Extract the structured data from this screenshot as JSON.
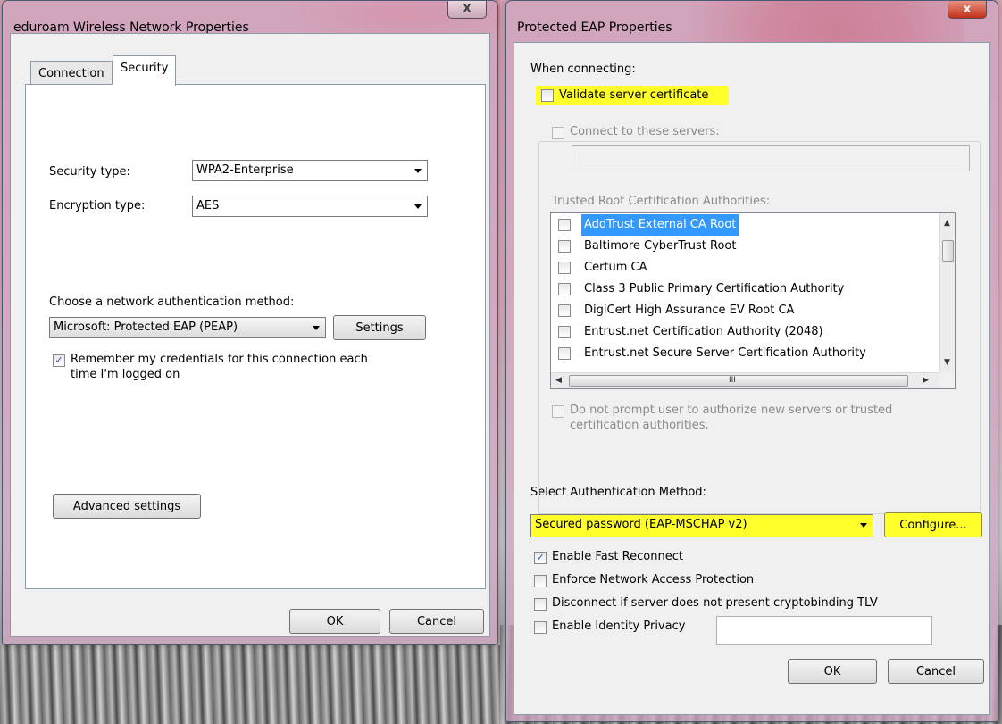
{
  "left_dialog": {
    "title": "eduroam Wireless Network Properties",
    "close_glyph": "X",
    "tabs": [
      {
        "label": "Connection"
      },
      {
        "label": "Security"
      }
    ],
    "security_type_label": "Security type:",
    "security_type_value": "WPA2-Enterprise",
    "encryption_type_label": "Encryption type:",
    "encryption_type_value": "AES",
    "auth_method_label": "Choose a network authentication method:",
    "auth_method_value": "Microsoft: Protected EAP (PEAP)",
    "settings_button": "Settings",
    "remember_credentials_line1": "Remember my credentials for this connection each",
    "remember_credentials_line2": "time I'm logged on",
    "remember_credentials_checked": true,
    "advanced_button": "Advanced settings",
    "ok_button": "OK",
    "cancel_button": "Cancel"
  },
  "right_dialog": {
    "title": "Protected EAP Properties",
    "close_glyph": "x",
    "when_connecting_label": "When connecting:",
    "validate_server_label": "Validate server certificate",
    "validate_server_checked": false,
    "connect_to_servers_label": "Connect to these servers:",
    "servers_input_value": "",
    "trusted_roots_label": "Trusted Root Certification Authorities:",
    "trusted_roots": [
      {
        "name": "AddTrust External CA Root",
        "checked": false,
        "selected": true
      },
      {
        "name": "Baltimore CyberTrust Root",
        "checked": false,
        "selected": false
      },
      {
        "name": "Certum CA",
        "checked": false,
        "selected": false
      },
      {
        "name": "Class 3 Public Primary Certification Authority",
        "checked": false,
        "selected": false
      },
      {
        "name": "DigiCert High Assurance EV Root CA",
        "checked": false,
        "selected": false
      },
      {
        "name": "Entrust.net Certification Authority (2048)",
        "checked": false,
        "selected": false
      },
      {
        "name": "Entrust.net Secure Server Certification Authority",
        "checked": false,
        "selected": false
      }
    ],
    "scroll_mark": "III",
    "do_not_prompt_line1": "Do not prompt user to authorize new servers or trusted",
    "do_not_prompt_line2": "certification authorities.",
    "select_auth_label": "Select Authentication Method:",
    "auth_method_value": "Secured password (EAP-MSCHAP v2)",
    "configure_button": "Configure...",
    "options": [
      {
        "label": "Enable Fast Reconnect",
        "checked": true
      },
      {
        "label": "Enforce Network Access Protection",
        "checked": false
      },
      {
        "label": "Disconnect if server does not present cryptobinding TLV",
        "checked": false
      },
      {
        "label": "Enable Identity Privacy",
        "checked": false
      }
    ],
    "identity_privacy_value": "",
    "ok_button": "OK",
    "cancel_button": "Cancel"
  },
  "colors": {
    "highlight": "#ffff2a",
    "selection": "#3399ff",
    "dialog_bg": "#f0f0f0"
  }
}
